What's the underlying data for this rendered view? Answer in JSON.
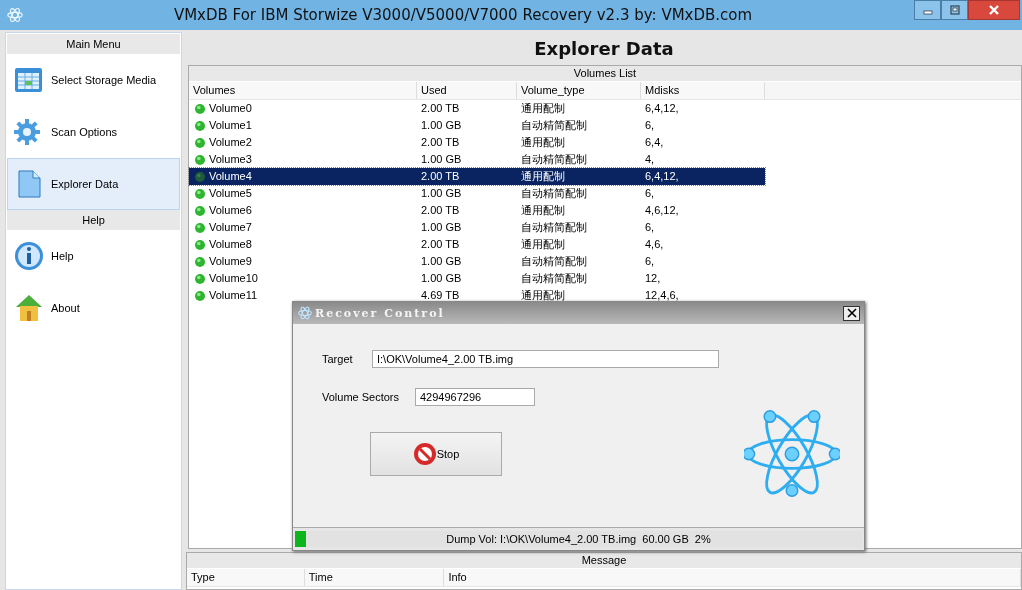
{
  "window": {
    "title": "VMxDB For IBM Storwize V3000/V5000/V7000 Recovery v2.3 by: VMxDB.com"
  },
  "sidebar": {
    "sections": [
      {
        "title": "Main Menu",
        "items": [
          {
            "label": "Select Storage Media",
            "kind": "media",
            "selected": false
          },
          {
            "label": "Scan Options",
            "kind": "gear",
            "selected": false
          },
          {
            "label": "Explorer Data",
            "kind": "doc",
            "selected": true
          }
        ]
      },
      {
        "title": "Help",
        "items": [
          {
            "label": "Help",
            "kind": "info",
            "selected": false
          },
          {
            "label": "About",
            "kind": "house",
            "selected": false
          }
        ]
      }
    ]
  },
  "heading": "Explorer Data",
  "volumes_list": {
    "title": "Volumes List",
    "columns": [
      "Volumes",
      "Used",
      "Volume_type",
      "Mdisks"
    ],
    "rows": [
      {
        "name": "Volume0",
        "used": "2.00 TB",
        "type": "通用配制",
        "mdisks": "6,4,12,",
        "selected": false
      },
      {
        "name": "Volume1",
        "used": "1.00 GB",
        "type": "自动精简配制",
        "mdisks": "6,",
        "selected": false
      },
      {
        "name": "Volume2",
        "used": "2.00 TB",
        "type": "通用配制",
        "mdisks": "6,4,",
        "selected": false
      },
      {
        "name": "Volume3",
        "used": "1.00 GB",
        "type": "自动精简配制",
        "mdisks": "4,",
        "selected": false
      },
      {
        "name": "Volume4",
        "used": "2.00 TB",
        "type": "通用配制",
        "mdisks": "6,4,12,",
        "selected": true
      },
      {
        "name": "Volume5",
        "used": "1.00 GB",
        "type": "自动精简配制",
        "mdisks": "6,",
        "selected": false
      },
      {
        "name": "Volume6",
        "used": "2.00 TB",
        "type": "通用配制",
        "mdisks": "4,6,12,",
        "selected": false
      },
      {
        "name": "Volume7",
        "used": "1.00 GB",
        "type": "自动精简配制",
        "mdisks": "6,",
        "selected": false
      },
      {
        "name": "Volume8",
        "used": "2.00 TB",
        "type": "通用配制",
        "mdisks": "4,6,",
        "selected": false
      },
      {
        "name": "Volume9",
        "used": "1.00 GB",
        "type": "自动精简配制",
        "mdisks": "6,",
        "selected": false
      },
      {
        "name": "Volume10",
        "used": "1.00 GB",
        "type": "自动精简配制",
        "mdisks": "12,",
        "selected": false
      },
      {
        "name": "Volume11",
        "used": "4.69 TB",
        "type": "通用配制",
        "mdisks": "12,4,6,",
        "selected": false
      }
    ]
  },
  "message": {
    "title": "Message",
    "columns": [
      "Type",
      "Time",
      "Info"
    ]
  },
  "dialog": {
    "title": "Recover Control",
    "target_label": "Target",
    "target": "I:\\OK\\Volume4_2.00 TB.img",
    "sectors_label": "Volume Sectors",
    "sectors": "4294967296",
    "stop_button": "Stop",
    "progress": {
      "level": 0.02,
      "text": "Dump Vol: I:\\OK\\Volume4_2.00 TB.img  60.00 GB  2%"
    }
  }
}
